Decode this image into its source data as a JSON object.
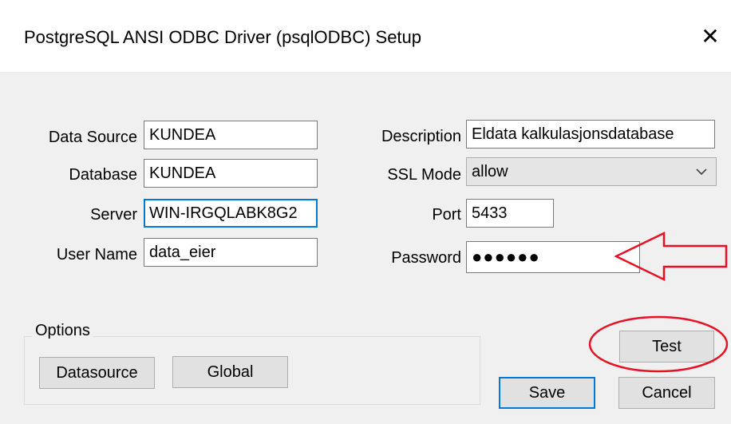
{
  "window": {
    "title": "PostgreSQL ANSI ODBC Driver (psqlODBC) Setup",
    "close_glyph": "✕"
  },
  "form": {
    "data_source": {
      "label": "Data Source",
      "value": "KUNDEA"
    },
    "database": {
      "label": "Database",
      "value": "KUNDEA"
    },
    "server": {
      "label": "Server",
      "value": "WIN-IRGQLABK8G2"
    },
    "user_name": {
      "label": "User Name",
      "value": "data_eier"
    },
    "description": {
      "label": "Description",
      "value": "Eldata kalkulasjonsdatabase"
    },
    "ssl_mode": {
      "label": "SSL Mode",
      "value": "allow"
    },
    "port": {
      "label": "Port",
      "value": "5433"
    },
    "password": {
      "label": "Password",
      "value": "●●●●●●"
    }
  },
  "options": {
    "legend": "Options",
    "datasource_label": "Datasource",
    "global_label": "Global"
  },
  "buttons": {
    "test": "Test",
    "save": "Save",
    "cancel": "Cancel"
  },
  "icons": {
    "close": "close-icon",
    "dropdown": "chevron-down-icon"
  },
  "colors": {
    "focus_border": "#0078d7",
    "annotation_red": "#e81123",
    "dialog_bg": "#f0f0f0"
  }
}
